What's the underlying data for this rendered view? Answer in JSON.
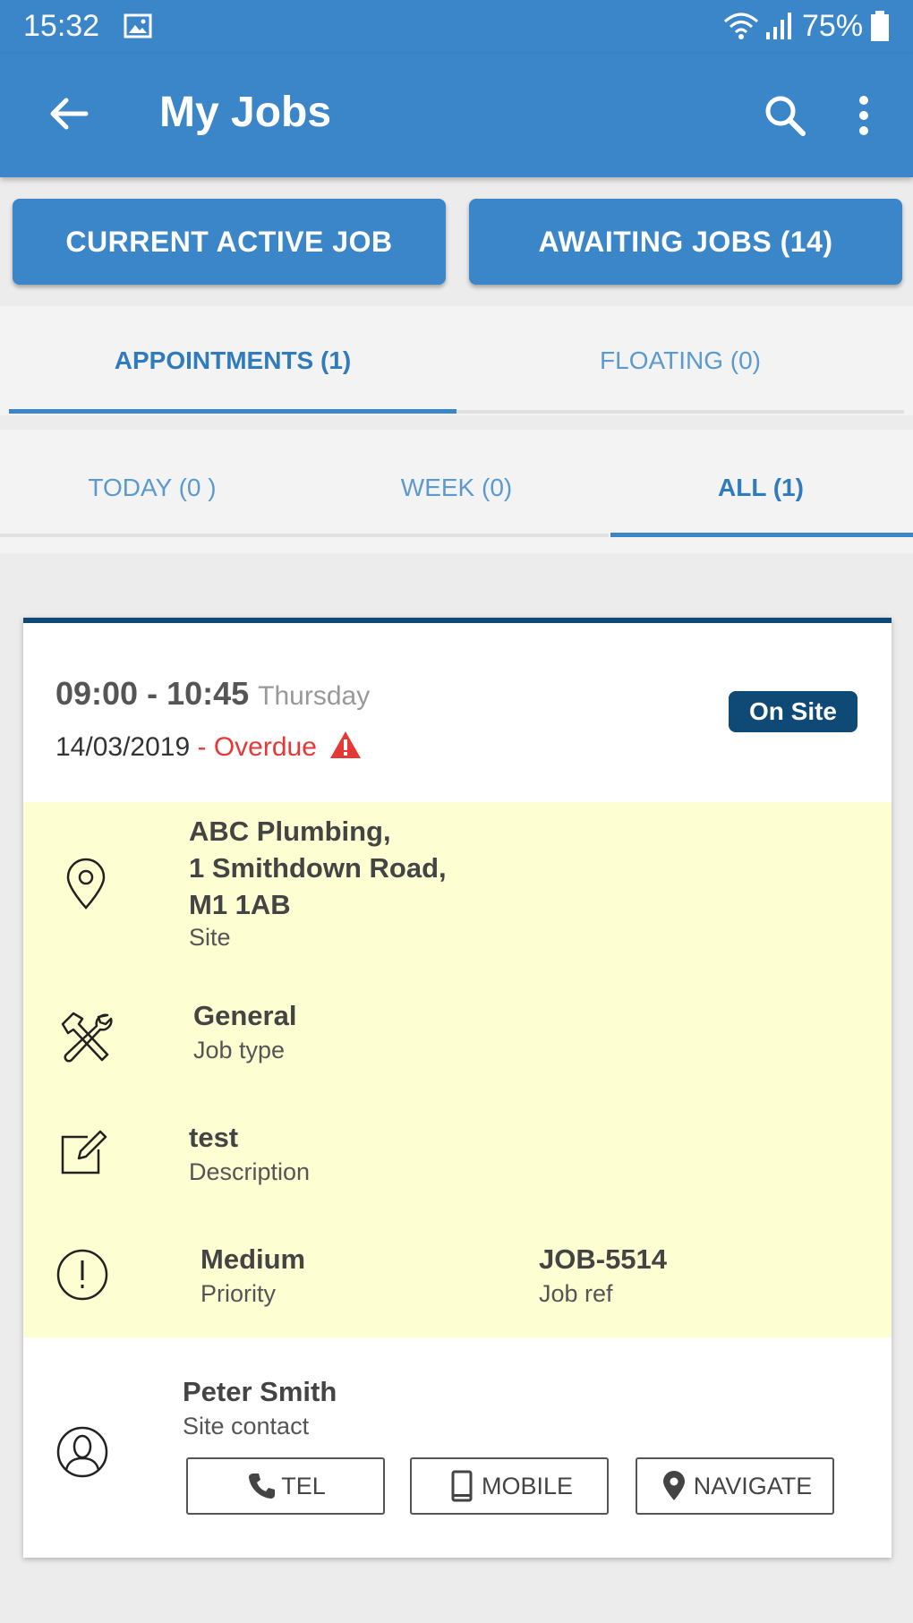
{
  "status_bar": {
    "time": "15:32",
    "battery": "75%",
    "icons": [
      "image-icon",
      "wifi-icon",
      "signal-icon",
      "battery-icon"
    ]
  },
  "app_bar": {
    "title": "My Jobs",
    "icons": [
      "back-arrow-icon",
      "search-icon",
      "more-vert-icon"
    ]
  },
  "buttons": {
    "current_active_job": "CURRENT ACTIVE JOB",
    "awaiting_jobs": "AWAITING JOBS (14)"
  },
  "tabs": {
    "appointments": "APPOINTMENTS (1)",
    "floating": "FLOATING (0)",
    "selected": "appointments"
  },
  "filters": {
    "today": "TODAY (0 )",
    "week": "WEEK (0)",
    "all": "ALL (1)",
    "selected": "all"
  },
  "job": {
    "time_range": "09:00 - 10:45",
    "day": "Thursday",
    "date": "14/03/2019",
    "overdue_sep": " - ",
    "overdue": "Overdue",
    "status": "On Site",
    "site_line1": "ABC Plumbing,",
    "site_line2": "1 Smithdown Road,",
    "site_line3": "M1 1AB",
    "site_label": "Site",
    "job_type": "General",
    "job_type_label": "Job type",
    "description": "test",
    "description_label": "Description",
    "priority": "Medium",
    "priority_label": "Priority",
    "job_ref": "JOB-5514",
    "job_ref_label": "Job ref",
    "contact": "Peter Smith",
    "contact_label": "Site contact",
    "actions": {
      "tel": "TEL",
      "mobile": "MOBILE",
      "navigate": "NAVIGATE"
    }
  },
  "colors": {
    "primary": "#3a86c8",
    "dark_accent": "#0f4a77",
    "overdue": "#e53935",
    "details_bg": "#fefed3"
  }
}
